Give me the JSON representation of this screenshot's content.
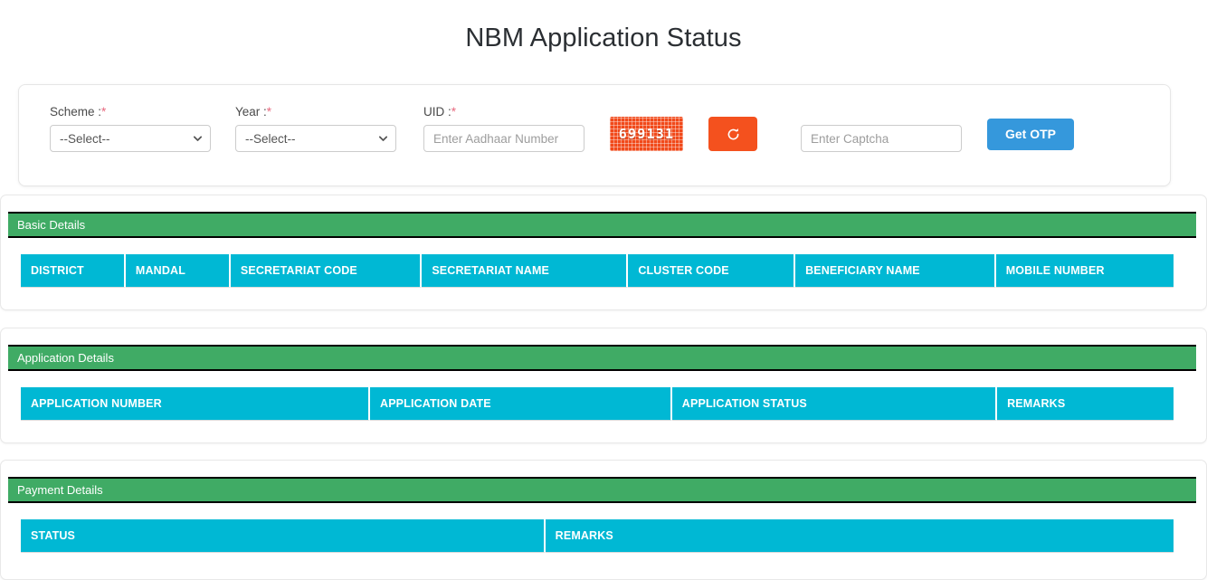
{
  "header": {
    "title": "NBM Application Status"
  },
  "form": {
    "scheme": {
      "label": "Scheme :",
      "required": "*",
      "value": "--Select--"
    },
    "year": {
      "label": "Year :",
      "required": "*",
      "value": "--Select--"
    },
    "uid": {
      "label": "UID :",
      "required": "*",
      "placeholder": "Enter Aadhaar Number",
      "value": ""
    },
    "captcha_image_text": "699131",
    "refresh_label": "",
    "captcha_input": {
      "placeholder": "Enter Captcha",
      "value": ""
    },
    "get_otp_label": "Get OTP"
  },
  "sections": [
    {
      "id": "basic-details",
      "title": "Basic Details",
      "columns": [
        {
          "label": "DISTRICT",
          "width": "9.1%"
        },
        {
          "label": "MANDAL",
          "width": "9.1%"
        },
        {
          "label": "SECRETARIAT CODE",
          "width": "16.6%"
        },
        {
          "label": "SECRETARIAT NAME",
          "width": "17.9%"
        },
        {
          "label": "CLUSTER CODE",
          "width": "14.5%"
        },
        {
          "label": "BENEFICIARY NAME",
          "width": "17.4%"
        },
        {
          "label": "MOBILE NUMBER",
          "width": "15.4%"
        }
      ],
      "rows": []
    },
    {
      "id": "application-details",
      "title": "Application Details",
      "columns": [
        {
          "label": "APPLICATION NUMBER",
          "width": "30.3%"
        },
        {
          "label": "APPLICATION DATE",
          "width": "26.2%"
        },
        {
          "label": "APPLICATION STATUS",
          "width": "28.2%"
        },
        {
          "label": "REMARKS",
          "width": "15.3%"
        }
      ],
      "rows": []
    },
    {
      "id": "payment-details",
      "title": "Payment Details",
      "columns": [
        {
          "label": "STATUS",
          "width": "45.5%"
        },
        {
          "label": "REMARKS",
          "width": "54.5%"
        }
      ],
      "rows": []
    }
  ],
  "colors": {
    "section_header_green": "#40ab65",
    "table_header_cyan": "#00b8d4",
    "primary_blue": "#3598dc",
    "captcha_orange": "#f4511e",
    "required_red": "#e8697f"
  }
}
